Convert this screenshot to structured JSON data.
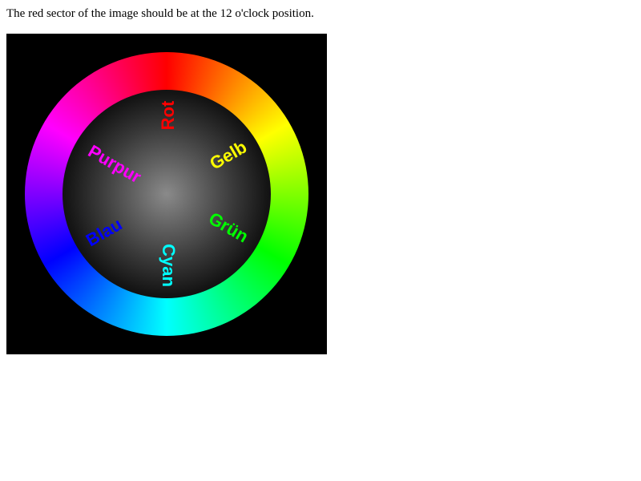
{
  "instruction": {
    "text": "The red sector of the image should be at the 12 o'clock position."
  },
  "wheel": {
    "labels": {
      "rot": "Rot",
      "gelb": "Gelb",
      "gruen": "Grün",
      "cyan": "Cyan",
      "blau": "Blau",
      "purpur": "Purpur"
    },
    "colors": {
      "rot": "#ff0000",
      "gelb": "#ffff00",
      "gruen": "#00ff00",
      "cyan": "#00ffff",
      "blau": "#0000ff",
      "purpur": "#ff00ff",
      "background": "#000000",
      "center": "#8a8a8a"
    }
  }
}
